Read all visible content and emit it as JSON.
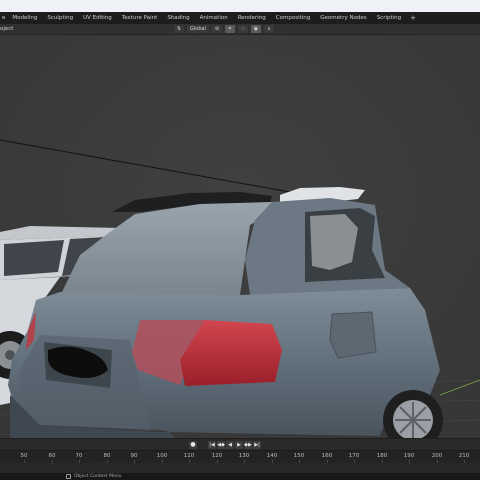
{
  "workspace_tabs": [
    "e",
    "Modeling",
    "Sculpting",
    "UV Editing",
    "Texture Paint",
    "Shading",
    "Animation",
    "Rendering",
    "Compositing",
    "Geometry Nodes",
    "Scripting"
  ],
  "add_workspace_label": "+",
  "header": {
    "left_label": "oject",
    "orientation_icon": "orientation-icon",
    "orientation_value": "Global",
    "pivot_icon": "pivot-link-icon",
    "snap_icon": "snap-icon",
    "snap_grid_icon": "snap-grid-icon",
    "proportional_icon": "proportional-edit-icon",
    "falloff_icon": "falloff-curve-icon"
  },
  "timeline": {
    "keyframe_icon": "●",
    "controls": [
      "|◀",
      "◀◆",
      "◀",
      "▶",
      "◆▶",
      "▶|"
    ],
    "frame_labels": [
      "50",
      "60",
      "70",
      "80",
      "90",
      "100",
      "110",
      "120",
      "130",
      "140",
      "150",
      "160",
      "170",
      "180",
      "190",
      "200",
      "210"
    ]
  },
  "status_bar": {
    "text": "Object Context Menu"
  },
  "colors": {
    "viewport_bg": "#3a3a3a",
    "header_bg": "#303030",
    "tabs_bg": "#1d1d1d",
    "car_body": "#6b7b8a",
    "taillight": "#c0303e"
  }
}
